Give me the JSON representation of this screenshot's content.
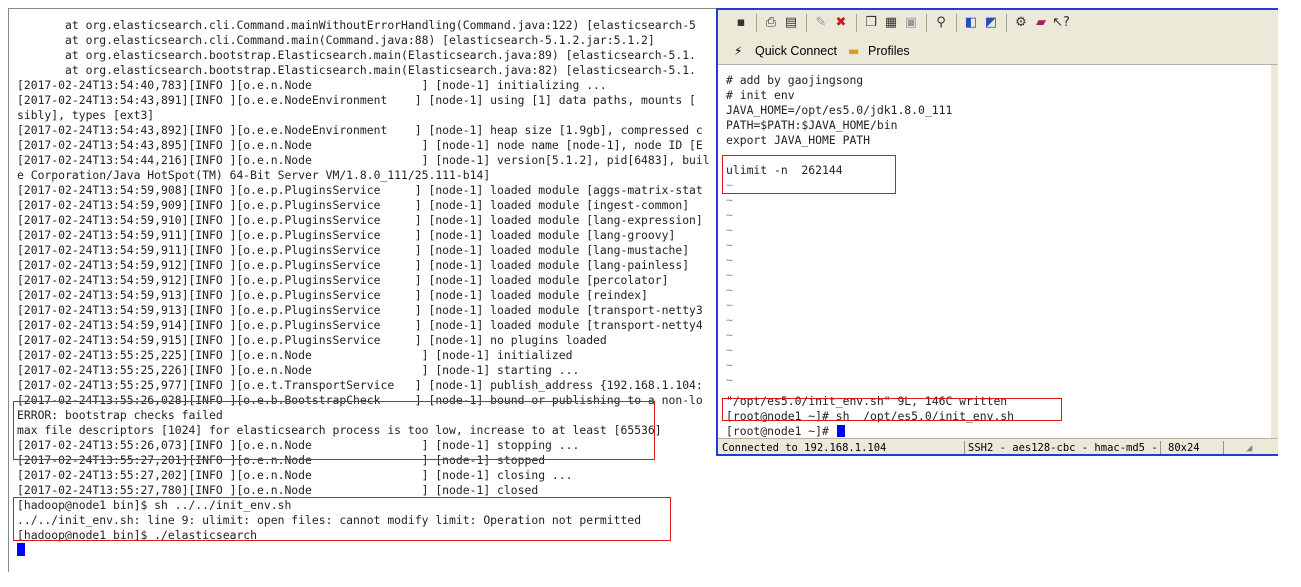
{
  "left_terminal": {
    "lines": [
      "       at org.elasticsearch.cli.Command.mainWithoutErrorHandling(Command.java:122) [elasticsearch-5",
      "       at org.elasticsearch.cli.Command.main(Command.java:88) [elasticsearch-5.1.2.jar:5.1.2]",
      "       at org.elasticsearch.bootstrap.Elasticsearch.main(Elasticsearch.java:89) [elasticsearch-5.1.",
      "       at org.elasticsearch.bootstrap.Elasticsearch.main(Elasticsearch.java:82) [elasticsearch-5.1.",
      "[2017-02-24T13:54:40,783][INFO ][o.e.n.Node                ] [node-1] initializing ...",
      "[2017-02-24T13:54:43,891][INFO ][o.e.e.NodeEnvironment    ] [node-1] using [1] data paths, mounts [",
      "sibly], types [ext3]",
      "[2017-02-24T13:54:43,892][INFO ][o.e.e.NodeEnvironment    ] [node-1] heap size [1.9gb], compressed c",
      "[2017-02-24T13:54:43,895][INFO ][o.e.n.Node                ] [node-1] node name [node-1], node ID [E",
      "[2017-02-24T13:54:44,216][INFO ][o.e.n.Node                ] [node-1] version[5.1.2], pid[6483], buil",
      "e Corporation/Java HotSpot(TM) 64-Bit Server VM/1.8.0_111/25.111-b14]",
      "[2017-02-24T13:54:59,908][INFO ][o.e.p.PluginsService     ] [node-1] loaded module [aggs-matrix-stat",
      "[2017-02-24T13:54:59,909][INFO ][o.e.p.PluginsService     ] [node-1] loaded module [ingest-common]",
      "[2017-02-24T13:54:59,910][INFO ][o.e.p.PluginsService     ] [node-1] loaded module [lang-expression]",
      "[2017-02-24T13:54:59,911][INFO ][o.e.p.PluginsService     ] [node-1] loaded module [lang-groovy]",
      "[2017-02-24T13:54:59,911][INFO ][o.e.p.PluginsService     ] [node-1] loaded module [lang-mustache]",
      "[2017-02-24T13:54:59,912][INFO ][o.e.p.PluginsService     ] [node-1] loaded module [lang-painless]",
      "[2017-02-24T13:54:59,912][INFO ][o.e.p.PluginsService     ] [node-1] loaded module [percolator]",
      "[2017-02-24T13:54:59,913][INFO ][o.e.p.PluginsService     ] [node-1] loaded module [reindex]",
      "[2017-02-24T13:54:59,913][INFO ][o.e.p.PluginsService     ] [node-1] loaded module [transport-netty3",
      "[2017-02-24T13:54:59,914][INFO ][o.e.p.PluginsService     ] [node-1] loaded module [transport-netty4",
      "[2017-02-24T13:54:59,915][INFO ][o.e.p.PluginsService     ] [node-1] no plugins loaded",
      "[2017-02-24T13:55:25,225][INFO ][o.e.n.Node                ] [node-1] initialized",
      "[2017-02-24T13:55:25,226][INFO ][o.e.n.Node                ] [node-1] starting ...",
      "[2017-02-24T13:55:25,977][INFO ][o.e.t.TransportService   ] [node-1] publish_address {192.168.1.104:",
      "[2017-02-24T13:55:26,028][INFO ][o.e.b.BootstrapCheck     ] [node-1] bound or publishing to a non-lo",
      "ERROR: bootstrap checks failed",
      "max file descriptors [1024] for elasticsearch process is too low, increase to at least [65536]",
      "[2017-02-24T13:55:26,073][INFO ][o.e.n.Node                ] [node-1] stopping ...",
      "[2017-02-24T13:55:27,201][INFO ][o.e.n.Node                ] [node-1] stopped",
      "[2017-02-24T13:55:27,202][INFO ][o.e.n.Node                ] [node-1] closing ...",
      "[2017-02-24T13:55:27,780][INFO ][o.e.n.Node                ] [node-1] closed",
      "[hadoop@node1 bin]$ sh ../../init_env.sh",
      "../../init_env.sh: line 9: ulimit: open files: cannot modify limit: Operation not permitted",
      "[hadoop@node1 bin]$ ./elasticsearch"
    ]
  },
  "right_window": {
    "quick_connect_label": "Quick Connect",
    "profiles_label": "Profiles",
    "editor_lines": [
      "# add by gaojingsong",
      "# init env",
      "JAVA_HOME=/opt/es5.0/jdk1.8.0_111",
      "PATH=$PATH:$JAVA_HOME/bin",
      "export JAVA_HOME PATH",
      "",
      "ulimit -n  262144"
    ],
    "tilde": "~",
    "written_line": "\"/opt/es5.0/init_env.sh\" 9L, 146C written",
    "cmd_line_1": "[root@node1 ~]# sh  /opt/es5.0/init_env.sh",
    "cmd_line_2": "[root@node1 ~]# ",
    "status": {
      "connection": "Connected to 192.168.1.104",
      "cipher": "SSH2 - aes128-cbc - hmac-md5 - :",
      "size": "80x24"
    }
  },
  "colors": {
    "highlight_box": "#e01818",
    "window_border": "#1f3ed8",
    "cursor": "#0000ff"
  }
}
